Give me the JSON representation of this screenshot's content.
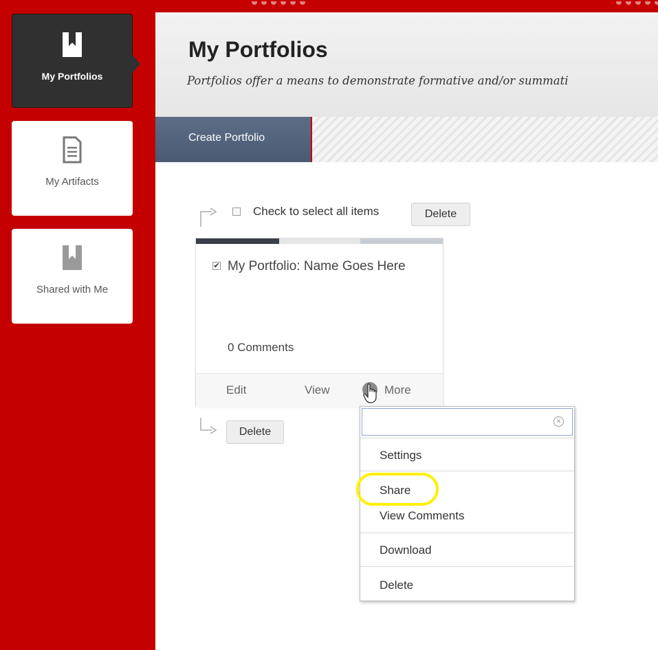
{
  "sidebar": {
    "items": [
      {
        "label": "My Portfolios",
        "icon": "portfolio-book-icon",
        "active": true
      },
      {
        "label": "My Artifacts",
        "icon": "document-icon",
        "active": false
      },
      {
        "label": "Shared with Me",
        "icon": "shared-book-icon",
        "active": false
      }
    ]
  },
  "header": {
    "title": "My Portfolios",
    "subtitle": "Portfolios offer a means to demonstrate formative and/or summati"
  },
  "actions": {
    "create_label": "Create Portfolio"
  },
  "list": {
    "select_all_label": "Check to select all items",
    "delete_label": "Delete",
    "bottom_delete_label": "Delete"
  },
  "card": {
    "title": "My Portfolio: Name Goes Here",
    "checked": true,
    "comments": "0 Comments",
    "links": {
      "edit": "Edit",
      "view": "View",
      "more": "More"
    }
  },
  "menu": {
    "items": [
      "Settings",
      "Share",
      "View Comments",
      "Download",
      "Delete"
    ],
    "highlighted": "Share"
  },
  "colors": {
    "brand_red": "#c40000",
    "active_tile": "#303030",
    "create_button": "#56657d",
    "highlight": "#ffef00"
  }
}
